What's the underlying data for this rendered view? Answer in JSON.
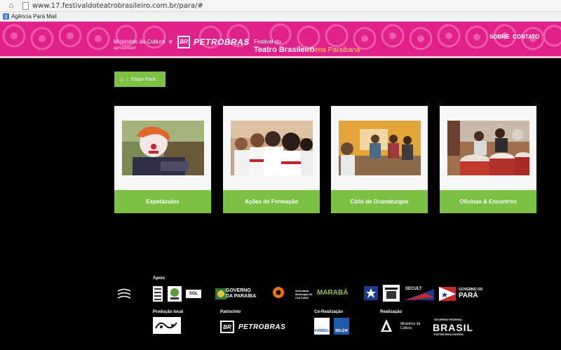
{
  "browser": {
    "url": "www.17.festivaldoteatrobrasileiro.com.br/para/#",
    "bookmark_label": "Agência Pará Mail"
  },
  "header": {
    "ministerio": "Ministério da Cultura",
    "e": "e",
    "apresentam": "apresentam",
    "br": "BR",
    "petrobras": "PETROBRAS",
    "festival_line1": "Festival do",
    "festival_line2": "Teatro Brasileiro",
    "cena": "Cena Paraibana",
    "nav": {
      "sobre": "SOBRE",
      "contato": "CONTATO"
    }
  },
  "breadcrumb": {
    "home_icon": "home-icon",
    "current": "Etapa Pará"
  },
  "cards": [
    {
      "label": "Espetáculos",
      "photo": "clown-photo"
    },
    {
      "label": "Ações de Formação",
      "photo": "students-photo"
    },
    {
      "label": "Ciclo de Dramaturgos",
      "photo": "meeting-photo"
    },
    {
      "label": "Oficinas & Encontros",
      "photo": "drums-photo"
    }
  ],
  "footer": {
    "apoio": "Apoio",
    "producao": "Produção local",
    "patrocinio": "Patrocínio",
    "corealizacao": "Co-Realização",
    "realizacao": "Realização",
    "logos": {
      "sol": "SOL",
      "governo_paraiba_1": "GOVERNO",
      "governo_paraiba_2": "DA PARAÍBA",
      "maraba": "MARABÁ",
      "seminc": "Secretaria Municipal de CULTURA",
      "secult": "SECULT",
      "governo_para_1": "GOVERNO DO",
      "governo_para_2": "PARÁ",
      "petrobras": "PETROBRAS",
      "br": "BR",
      "fumbel": "FUMBEL",
      "belem": "BELÉM",
      "ministerio_cultura": "Ministério da Cultura",
      "governo_federal": "GOVERNO FEDERAL",
      "brasil": "BRASIL",
      "patria": "PÁTRIA EDUCADORA"
    }
  },
  "colors": {
    "magenta": "#e0218a",
    "green": "#7bc143",
    "background": "#000000"
  }
}
